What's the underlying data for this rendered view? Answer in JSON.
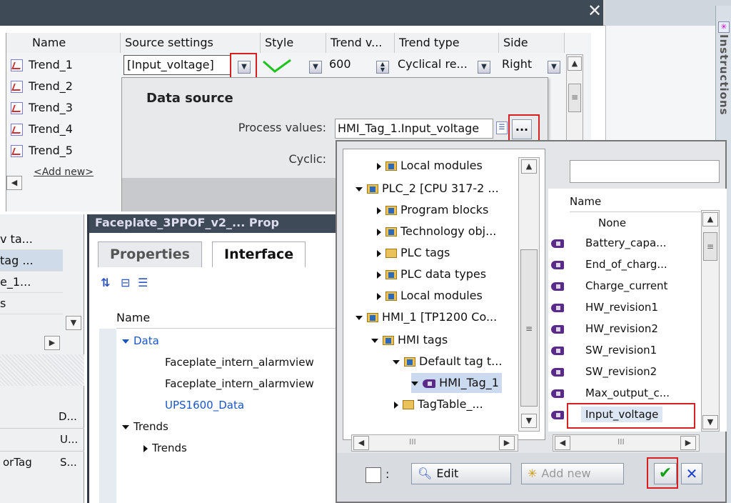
{
  "instructions_label": "Instructions",
  "grid": {
    "headers": [
      "Name",
      "Source settings",
      "Style",
      "Trend v...",
      "Trend type",
      "Side"
    ],
    "rows": [
      {
        "name": "Trend_1"
      },
      {
        "name": "Trend_2"
      },
      {
        "name": "Trend_3"
      },
      {
        "name": "Trend_4"
      },
      {
        "name": "Trend_5"
      }
    ],
    "add_new": "<Add new>",
    "trend1": {
      "source": "[Input_voltage]",
      "trend_value": "600",
      "trend_type": "Cyclical re...",
      "side": "Right"
    }
  },
  "popup": {
    "title": "Data source",
    "process_label": "Process values:",
    "process_value": "HMI_Tag_1.Input_voltage",
    "cyclic_label": "Cyclic:",
    "browse_btn": "..."
  },
  "left_list": [
    "v ta...",
    "tag ...",
    "e_1...",
    "s"
  ],
  "left_bottom": {
    "col1": "D...",
    "row1b": "U...",
    "row2a": "orTag",
    "row2b": "S..."
  },
  "faceplate": {
    "title": "Faceplate_3PPOF_v2_... Prop",
    "tabs": [
      "Properties",
      "Interface"
    ],
    "col_header": "Name",
    "items": [
      {
        "label": "Data",
        "color": "#1a55c8"
      },
      {
        "label": "Faceplate_intern_alarmview",
        "color": "#222"
      },
      {
        "label": "Faceplate_intern_alarmview",
        "color": "#222"
      },
      {
        "label": "UPS1600_Data",
        "color": "#1a55c8"
      },
      {
        "label": "Trends",
        "color": "#222"
      },
      {
        "label": "Trends",
        "color": "#222"
      }
    ]
  },
  "tree": {
    "items": [
      {
        "label": "Local modules"
      },
      {
        "label": "PLC_2 [CPU 317-2 ..."
      },
      {
        "label": "Program blocks"
      },
      {
        "label": "Technology obj..."
      },
      {
        "label": "PLC tags"
      },
      {
        "label": "PLC data types"
      },
      {
        "label": "Local modules"
      },
      {
        "label": "HMI_1 [TP1200 Co..."
      },
      {
        "label": "HMI tags"
      },
      {
        "label": "Default tag t..."
      },
      {
        "label": "HMI_Tag_1"
      },
      {
        "label": "TagTable_..."
      }
    ]
  },
  "taglist": {
    "header": "Name",
    "items": [
      "None",
      "Battery_capa...",
      "End_of_charg...",
      "Charge_current",
      "HW_revision1",
      "HW_revision2",
      "SW_revision1",
      "SW_revision2",
      "Max_output_c...",
      "Input_voltage"
    ]
  },
  "footer": {
    "colon": ":",
    "edit": "Edit",
    "add_new": "Add new",
    "scroll_mark": "III"
  }
}
